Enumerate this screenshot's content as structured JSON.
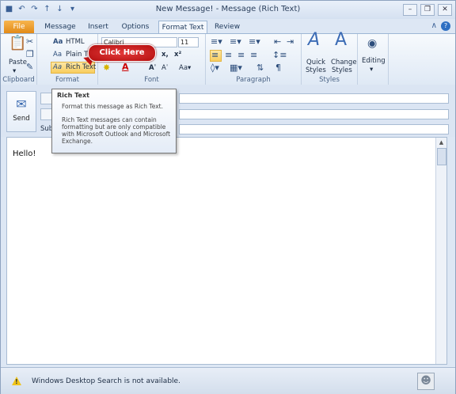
{
  "window": {
    "title": "New Message! - Message (Rich Text)"
  },
  "qat": {
    "save_icon": "save-icon",
    "undo_icon": "undo-icon",
    "redo_icon": "redo-icon",
    "up_icon": "up-icon",
    "down_icon": "down-icon"
  },
  "tabs": [
    {
      "label": "File"
    },
    {
      "label": "Message"
    },
    {
      "label": "Insert"
    },
    {
      "label": "Options"
    },
    {
      "label": "Format Text"
    },
    {
      "label": "Review"
    }
  ],
  "ribbon": {
    "clipboard": {
      "paste": "Paste",
      "label": "Clipboard"
    },
    "format": {
      "html": "HTML",
      "plain": "Plain T",
      "rich": "Rich Text",
      "label": "Format"
    },
    "font": {
      "name": "Calibri",
      "size": "11",
      "label": "Font"
    },
    "paragraph": {
      "label": "Paragraph"
    },
    "styles": {
      "quick": "Quick",
      "quick2": "Styles",
      "change": "Change",
      "change2": "Styles",
      "label": "Styles"
    },
    "editing": {
      "label": "Editing"
    }
  },
  "callout": {
    "text": "Click Here"
  },
  "header": {
    "send": "Send",
    "subject_prefix": "Sub"
  },
  "tooltip": {
    "title": "Rich Text",
    "line1": "Format this message as Rich Text.",
    "line2": "Rich Text messages can contain formatting but are only compatible with Microsoft Outlook and Microsoft Exchange."
  },
  "message": {
    "body": "Hello!"
  },
  "status": {
    "text": "Windows Desktop Search is not available."
  },
  "colors": {
    "file_tab": "#e28a18",
    "callout": "#c11515",
    "highlight": "#f8cd5e"
  }
}
